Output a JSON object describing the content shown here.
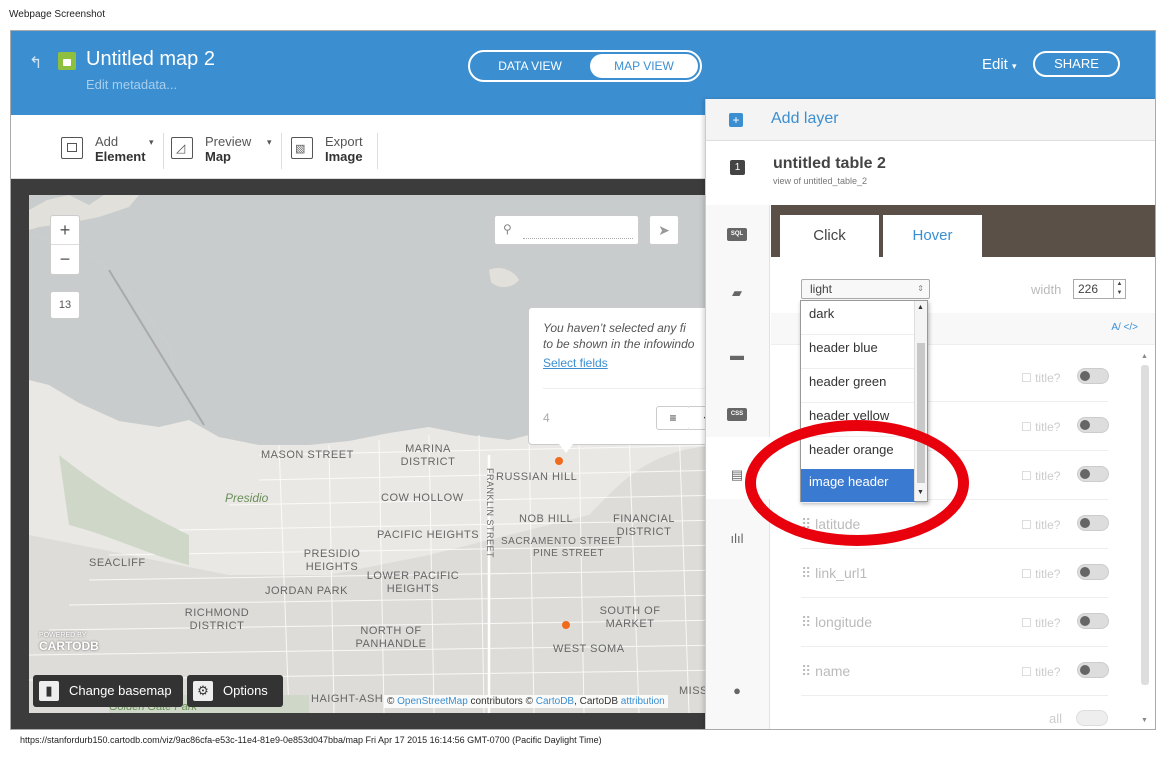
{
  "page": {
    "caption": "Webpage Screenshot",
    "url": "https://stanfordurb150.cartodb.com/viz/9ac86cfa-e53c-11e4-81e9-0e853d047bba/map Fri Apr 17 2015 16:14:56 GMT-0700 (Pacific Daylight Time)"
  },
  "header": {
    "title": "Untitled map 2",
    "meta_link": "Edit metadata...",
    "view_toggle": {
      "data": "DATA VIEW",
      "map": "MAP VIEW"
    },
    "edit": "Edit",
    "share": "SHARE"
  },
  "toolbar": {
    "add": {
      "line1": "Add",
      "line2": "Element"
    },
    "preview": {
      "line1": "Preview",
      "line2": "Map"
    },
    "export": {
      "line1": "Export",
      "line2": "Image"
    }
  },
  "map": {
    "zoom_level": "13",
    "zoom_in": "+",
    "zoom_out": "−",
    "popup": {
      "text_line1": "You haven’t selected any fi",
      "text_line2": "to be shown in the infowindo",
      "link": "Select fields",
      "count": "4",
      "btn_list": "≡",
      "btn_move": "✥"
    },
    "labels": [
      "MASON STREET",
      "MARINA DISTRICT",
      "Presidio",
      "COW HOLLOW",
      "RUSSIAN HILL",
      "FRANKLIN STREET",
      "NOB HILL",
      "FINANCIAL DISTRICT",
      "PACIFIC HEIGHTS",
      "SACRAMENTO STREET",
      "PINE STREET",
      "SEACLIFF",
      "PRESIDIO HEIGHTS",
      "LOWER PACIFIC HEIGHTS",
      "JORDAN PARK",
      "RICHMOND DISTRICT",
      "NORTH OF PANHANDLE",
      "SOUTH OF MARKET",
      "WEST SOMA",
      "HAIGHT-ASH",
      "Golden Gate Park",
      "MISSION"
    ],
    "logo_small": "POWERED BY",
    "logo": "CARTODB",
    "change_basemap": "Change basemap",
    "options": "Options",
    "attribution": {
      "prefix": "©",
      "osm": "OpenStreetMap",
      "mid": "contributors ©",
      "cartodb": "CartoDB",
      "tail": ", CartoDB",
      "attr": "attribution"
    }
  },
  "panel": {
    "add_layer": "Add layer",
    "layer_number": "1",
    "layer_name": "untitled table 2",
    "layer_sub": "view of untitled_table_2",
    "rail": [
      "SQL",
      "style",
      "infowindow",
      "CSS",
      "legends",
      "filters",
      "wizard"
    ],
    "tabs": {
      "click": "Click",
      "hover": "Hover"
    },
    "theme_select": "light",
    "width_label": "width",
    "width_value": "226",
    "fields": [
      "latitude",
      "link_url1",
      "longitude",
      "name"
    ],
    "field_title_label": "title?",
    "all_label": "all",
    "code_icons": "A/ </>"
  },
  "dropdown": {
    "options": [
      "dark",
      "header blue",
      "header green",
      "header yellow",
      "header orange",
      "image header"
    ],
    "selected": "image header"
  },
  "colors": {
    "header_blue": "#3b8fd1",
    "annotation_red": "#e8000c",
    "selected_option": "#3a7ad0"
  }
}
